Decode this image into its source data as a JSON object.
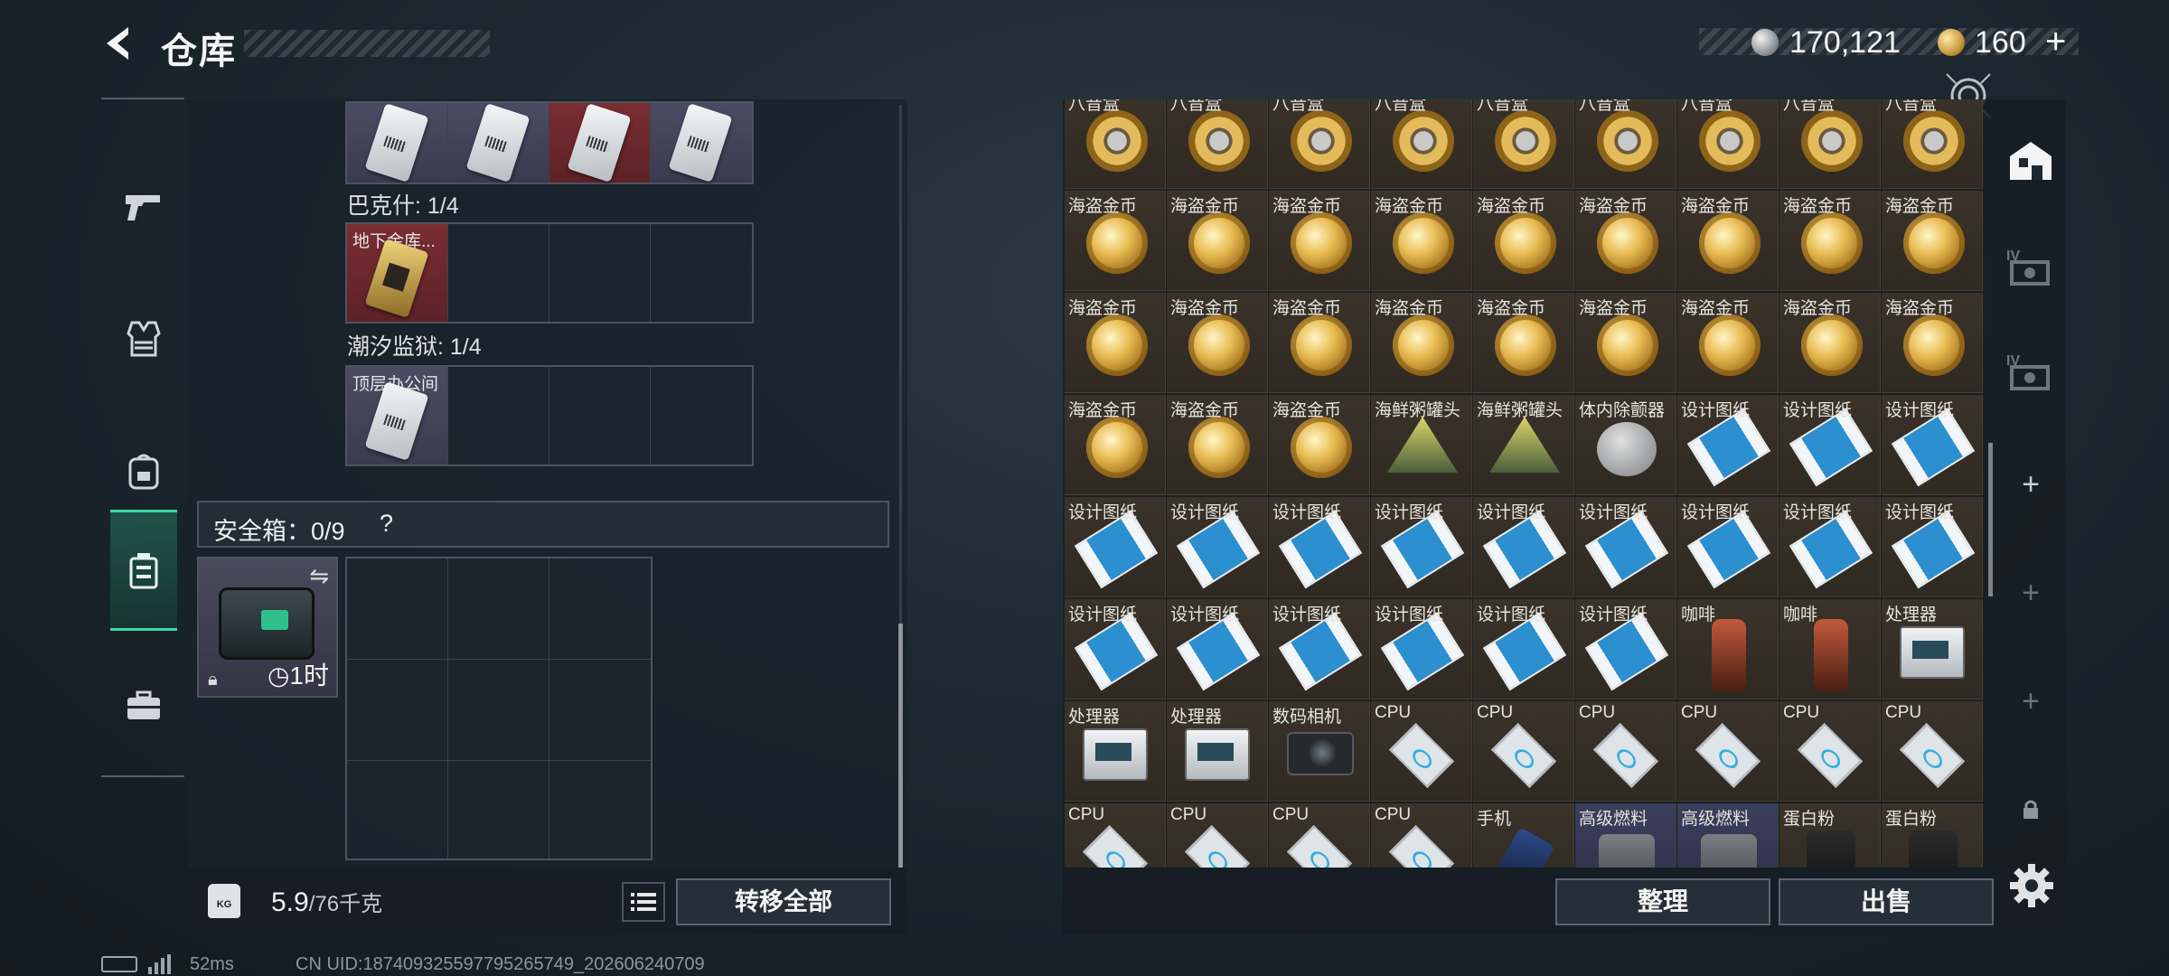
{
  "header": {
    "title": "仓库",
    "silver_amount": "170,121",
    "gold_amount": "160",
    "gold_add": "+"
  },
  "left_sidebar": {
    "categories": [
      {
        "icon": "pistol-icon",
        "active": false
      },
      {
        "icon": "armor-vest-icon",
        "active": false
      },
      {
        "icon": "backpack-icon",
        "active": false
      },
      {
        "icon": "secure-container-icon",
        "active": true
      },
      {
        "icon": "briefcase-icon",
        "active": false
      }
    ]
  },
  "left_panel": {
    "groups": [
      {
        "label": "",
        "slots": [
          {
            "label": "",
            "color": "purple",
            "item": "keycard"
          },
          {
            "label": "",
            "color": "purple",
            "item": "keycard"
          },
          {
            "label": "",
            "color": "red",
            "item": "keycard"
          },
          {
            "label": "",
            "color": "purple",
            "item": "keycard"
          }
        ]
      },
      {
        "label": "巴克什: 1/4",
        "slots": [
          {
            "label": "地下金库...",
            "color": "red",
            "item": "gold-keycard"
          },
          {
            "label": "",
            "color": "",
            "item": ""
          },
          {
            "label": "",
            "color": "",
            "item": ""
          },
          {
            "label": "",
            "color": "",
            "item": ""
          }
        ]
      },
      {
        "label": "潮汐监狱: 1/4",
        "slots": [
          {
            "label": "顶层办公间",
            "color": "purple",
            "item": "keycard"
          },
          {
            "label": "",
            "color": "",
            "item": ""
          },
          {
            "label": "",
            "color": "",
            "item": ""
          },
          {
            "label": "",
            "color": "",
            "item": ""
          }
        ]
      }
    ],
    "safe_title": "安全箱：0/9",
    "safe_help": "?",
    "safe_time": "1时",
    "weight_icon_text": "KG",
    "weight_value": "5.9",
    "weight_capacity": "/76千克",
    "transfer_all": "转移全部"
  },
  "right_panel": {
    "rows": [
      {
        "label": "八音盒",
        "art": "music",
        "count": 9
      },
      {
        "label": "海盗金币",
        "art": "coin",
        "count": 9
      },
      {
        "label": "海盗金币",
        "art": "coin",
        "count": 9
      },
      {
        "items": [
          {
            "label": "海盗金币",
            "art": "coin"
          },
          {
            "label": "海盗金币",
            "art": "coin"
          },
          {
            "label": "海盗金币",
            "art": "coin"
          },
          {
            "label": "海鲜粥罐头",
            "art": "can"
          },
          {
            "label": "海鲜粥罐头",
            "art": "can"
          },
          {
            "label": "体内除颤器",
            "art": "remover"
          },
          {
            "label": "设计图纸",
            "art": "blueprint"
          },
          {
            "label": "设计图纸",
            "art": "blueprint"
          },
          {
            "label": "设计图纸",
            "art": "blueprint"
          }
        ]
      },
      {
        "label": "设计图纸",
        "art": "blueprint",
        "count": 9
      },
      {
        "items": [
          {
            "label": "设计图纸",
            "art": "blueprint"
          },
          {
            "label": "设计图纸",
            "art": "blueprint"
          },
          {
            "label": "设计图纸",
            "art": "blueprint"
          },
          {
            "label": "设计图纸",
            "art": "blueprint"
          },
          {
            "label": "设计图纸",
            "art": "blueprint"
          },
          {
            "label": "设计图纸",
            "art": "blueprint"
          },
          {
            "label": "咖啡",
            "art": "coffee"
          },
          {
            "label": "咖啡",
            "art": "coffee"
          },
          {
            "label": "处理器",
            "art": "proc"
          }
        ]
      },
      {
        "items": [
          {
            "label": "处理器",
            "art": "proc"
          },
          {
            "label": "处理器",
            "art": "proc"
          },
          {
            "label": "数码相机",
            "art": "camera"
          },
          {
            "label": "CPU",
            "art": "cpu"
          },
          {
            "label": "CPU",
            "art": "cpu"
          },
          {
            "label": "CPU",
            "art": "cpu"
          },
          {
            "label": "CPU",
            "art": "cpu"
          },
          {
            "label": "CPU",
            "art": "cpu"
          },
          {
            "label": "CPU",
            "art": "cpu"
          }
        ]
      },
      {
        "items": [
          {
            "label": "CPU",
            "art": "cpu"
          },
          {
            "label": "CPU",
            "art": "cpu"
          },
          {
            "label": "CPU",
            "art": "cpu"
          },
          {
            "label": "CPU",
            "art": "cpu"
          },
          {
            "label": "手机",
            "art": "phone"
          },
          {
            "label": "高级燃料",
            "art": "fuel",
            "blue": true
          },
          {
            "label": "高级燃料",
            "art": "fuel",
            "blue": true
          },
          {
            "label": "蛋白粉",
            "art": "protein"
          },
          {
            "label": "蛋白粉",
            "art": "protein"
          }
        ]
      }
    ],
    "sort_label": "整理",
    "sell_label": "出售"
  },
  "right_sidebar": {
    "tabs": [
      {
        "icon": "home-storage-icon",
        "kind": "icon"
      },
      {
        "icon": "storage-tab-iv-icon",
        "kind": "icon"
      },
      {
        "icon": "storage-tab-iv-icon",
        "kind": "icon"
      },
      {
        "icon": "add-tab-icon",
        "kind": "plus"
      },
      {
        "icon": "add-tab-icon",
        "kind": "plus-dim"
      },
      {
        "icon": "add-tab-icon",
        "kind": "plus-dim"
      },
      {
        "icon": "locked-tab-icon",
        "kind": "lock"
      }
    ]
  },
  "status": {
    "ping": "52ms",
    "uid": "CN UID:18740932559779526574​9_202606240709"
  },
  "colors": {
    "accent": "#3fd6a4",
    "slot_purple": "#4d4b63",
    "slot_red": "#7a2d33",
    "item_bg": "#3b332a"
  }
}
